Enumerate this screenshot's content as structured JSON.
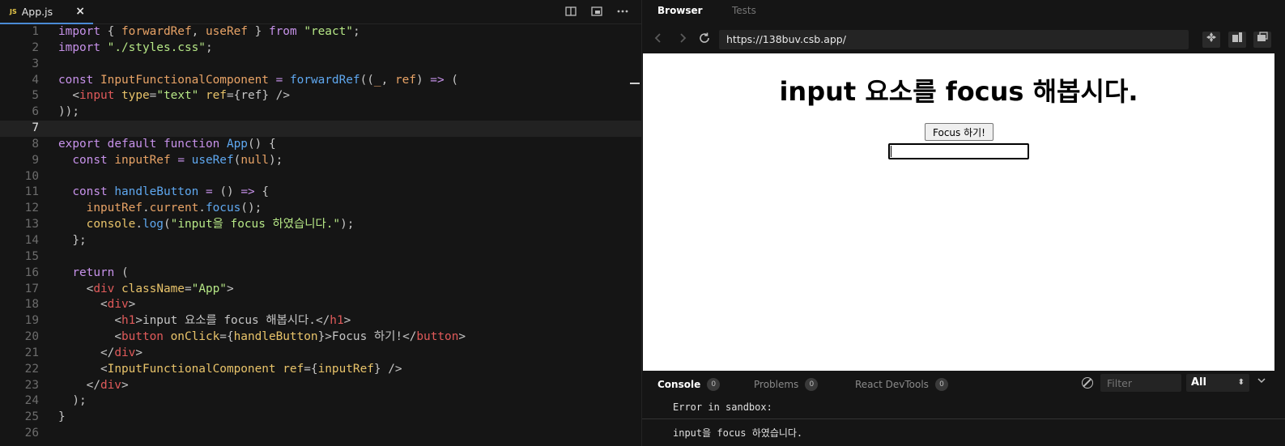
{
  "editor": {
    "tab": {
      "badge": "JS",
      "label": "App.js",
      "close": "×"
    },
    "tools": [
      "split-view",
      "preview",
      "more"
    ],
    "lines": [
      {
        "n": "1"
      },
      {
        "n": "2"
      },
      {
        "n": "3"
      },
      {
        "n": "4"
      },
      {
        "n": "5"
      },
      {
        "n": "6"
      },
      {
        "n": "7"
      },
      {
        "n": "8"
      },
      {
        "n": "9"
      },
      {
        "n": "10"
      },
      {
        "n": "11"
      },
      {
        "n": "12"
      },
      {
        "n": "13"
      },
      {
        "n": "14"
      },
      {
        "n": "15"
      },
      {
        "n": "16"
      },
      {
        "n": "17"
      },
      {
        "n": "18"
      },
      {
        "n": "19"
      },
      {
        "n": "20"
      },
      {
        "n": "21"
      },
      {
        "n": "22"
      },
      {
        "n": "23"
      },
      {
        "n": "24"
      },
      {
        "n": "25"
      },
      {
        "n": "26"
      }
    ],
    "active_line": "7"
  },
  "preview": {
    "tabs": {
      "browser": "Browser",
      "tests": "Tests"
    },
    "url": "https://138buv.csb.app/",
    "page": {
      "heading": "input 요소를 focus 해봅시다.",
      "button": "Focus 하기!"
    },
    "console": {
      "tabs": [
        {
          "label": "Console",
          "count": "0"
        },
        {
          "label": "Problems",
          "count": "0"
        },
        {
          "label": "React DevTools",
          "count": "0"
        }
      ],
      "filter_placeholder": "Filter",
      "level": "All",
      "lines": [
        "Error in sandbox:",
        "input을 focus 하였습니다."
      ]
    }
  },
  "colors": {
    "keyword": "#c792ea",
    "identifier": "#e8a366",
    "string": "#b6e786",
    "function": "#5fa8f0",
    "tag": "#e05a5a",
    "accent": "#4a8bd6"
  }
}
